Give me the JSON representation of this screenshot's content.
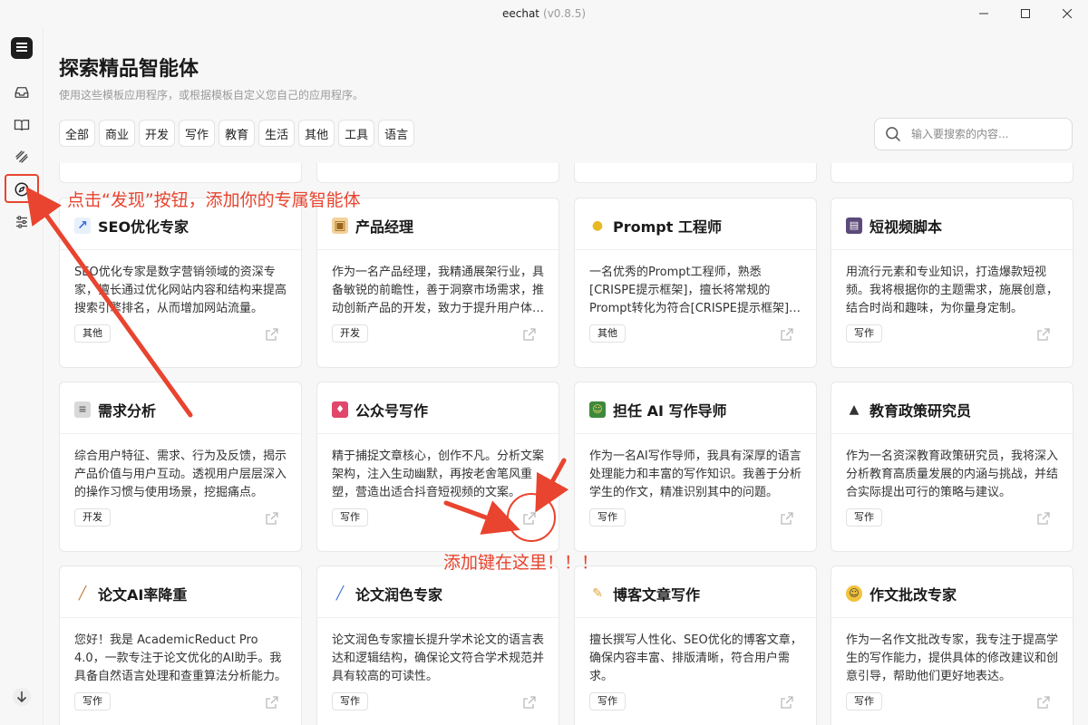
{
  "window": {
    "app_name": "eechat",
    "version": "(v0.8.5)"
  },
  "page": {
    "title": "探索精品智能体",
    "subtitle": "使用这些模板应用程序，或根据模板自定义您自己的应用程序。"
  },
  "filters": [
    "全部",
    "商业",
    "开发",
    "写作",
    "教育",
    "生活",
    "其他",
    "工具",
    "语言"
  ],
  "search": {
    "placeholder": "输入要搜索的内容..."
  },
  "cards": [
    {
      "name": "SEO优化专家",
      "icon": "chart-emoji-icon",
      "desc": "SEO优化专家是数字营销领域的资深专家，擅长通过优化网站内容和结构来提高搜索引擎排名，从而增加网站流量。",
      "tag": "其他"
    },
    {
      "name": "产品经理",
      "icon": "package-emoji-icon",
      "desc": "作为一名产品经理，我精通展架行业，具备敏锐的前瞻性，善于洞察市场需求，推动创新产品的开发，致力于提升用户体验。",
      "tag": "开发"
    },
    {
      "name": "Prompt 工程师",
      "icon": "lightbulb-emoji-icon",
      "desc": "一名优秀的Prompt工程师，熟悉[CRISPE提示框架]，擅长将常规的Prompt转化为符合[CRISPE提示框架]的优秀Prompt。",
      "tag": "其他"
    },
    {
      "name": "短视频脚本",
      "icon": "clapperboard-emoji-icon",
      "desc": "用流行元素和专业知识，打造爆款短视频。我将根据你的主题需求，施展创意，结合时尚和趣味，为你量身定制。",
      "tag": "写作"
    },
    {
      "name": "需求分析",
      "icon": "memo-emoji-icon",
      "desc": "综合用户特征、需求、行为及反馈，揭示产品价值与用户互动。透视用户层层深入的操作习惯与使用场景，挖掘痛点。",
      "tag": "开发"
    },
    {
      "name": "公众号写作",
      "icon": "bookmark-emoji-icon",
      "desc": "精于捕捉文章核心，创作不凡。分析文案架构，注入生动幽默，再按老舍笔风重塑，营造出适合抖音短视频的文案。",
      "tag": "写作"
    },
    {
      "name": "担任 AI 写作导师",
      "icon": "teacher-emoji-icon",
      "desc": "作为一名AI写作导师，我具有深厚的语言处理能力和丰富的写作知识。我善于分析学生的作文，精准识别其中的问题。",
      "tag": "写作"
    },
    {
      "name": "教育政策研究员",
      "icon": "graduation-cap-emoji-icon",
      "desc": "作为一名资深教育政策研究员，我将深入分析教育高质量发展的内涵与挑战，并结合实际提出可行的策略与建议。",
      "tag": "写作"
    },
    {
      "name": "论文AI率降重",
      "icon": "broom-emoji-icon",
      "desc": "您好！我是 AcademicReduct Pro 4.0，一款专注于论文优化的AI助手。我具备自然语言处理和查重算法分析能力。",
      "tag": "写作"
    },
    {
      "name": "论文润色专家",
      "icon": "pen-emoji-icon",
      "desc": "论文润色专家擅长提升学术论文的语言表达和逻辑结构，确保论文符合学术规范并具有较高的可读性。",
      "tag": "写作"
    },
    {
      "name": "博客文章写作",
      "icon": "writing-hand-emoji-icon",
      "desc": "擅长撰写人性化、SEO优化的博客文章，确保内容丰富、排版清晰，符合用户需求。",
      "tag": "写作"
    },
    {
      "name": "作文批改专家",
      "icon": "glasses-face-emoji-icon",
      "desc": "作为一名作文批改专家，我专注于提高学生的写作能力，提供具体的修改建议和创意引导，帮助他们更好地表达。",
      "tag": "写作"
    }
  ],
  "annotations": {
    "discover_tip": "点击“发现”按钮，添加你的专属智能体",
    "add_tip": "添加键在这里！！！",
    "color": "#e8442f"
  }
}
